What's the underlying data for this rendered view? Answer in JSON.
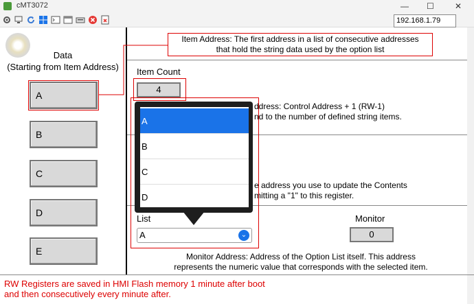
{
  "window": {
    "title": "cMT3072",
    "minimize": "—",
    "maximize": "☐",
    "close": "✕"
  },
  "toolbar": {
    "ip_address": "192.168.1.79"
  },
  "left": {
    "heading": "Data",
    "subheading": "(Starting from Item Address)",
    "buttons": [
      "A",
      "B",
      "C",
      "D",
      "E"
    ]
  },
  "callout": {
    "line1": "Item Address: The first address in a list of consecutive addresses",
    "line2": "that hold the string data used by the option list"
  },
  "item_count": {
    "label": "Item Count",
    "value": "4"
  },
  "count_text": {
    "line1": "ddress: Control Address + 1 (RW-1)",
    "line2": "nd to the number of defined string items."
  },
  "update_text": {
    "line1": "e address you use to update the Contents",
    "line2": "mitting a \"1\" to this register."
  },
  "popup": {
    "options": [
      "A",
      "B",
      "C",
      "D"
    ],
    "selected": "A"
  },
  "list": {
    "label": "List",
    "value": "A"
  },
  "monitor": {
    "label": "Monitor",
    "value": "0"
  },
  "monitor_text": {
    "line1": "Monitor Address: Address of the Option List itself. This address",
    "line2": "represents the numeric value that corresponds with the selected item."
  },
  "footer": {
    "line1": "RW Registers are saved in HMI Flash memory 1 minute after boot",
    "line2": "and then consecutively every minute after."
  },
  "colors": {
    "annotation": "#dd0000",
    "selection": "#1a73e8"
  }
}
